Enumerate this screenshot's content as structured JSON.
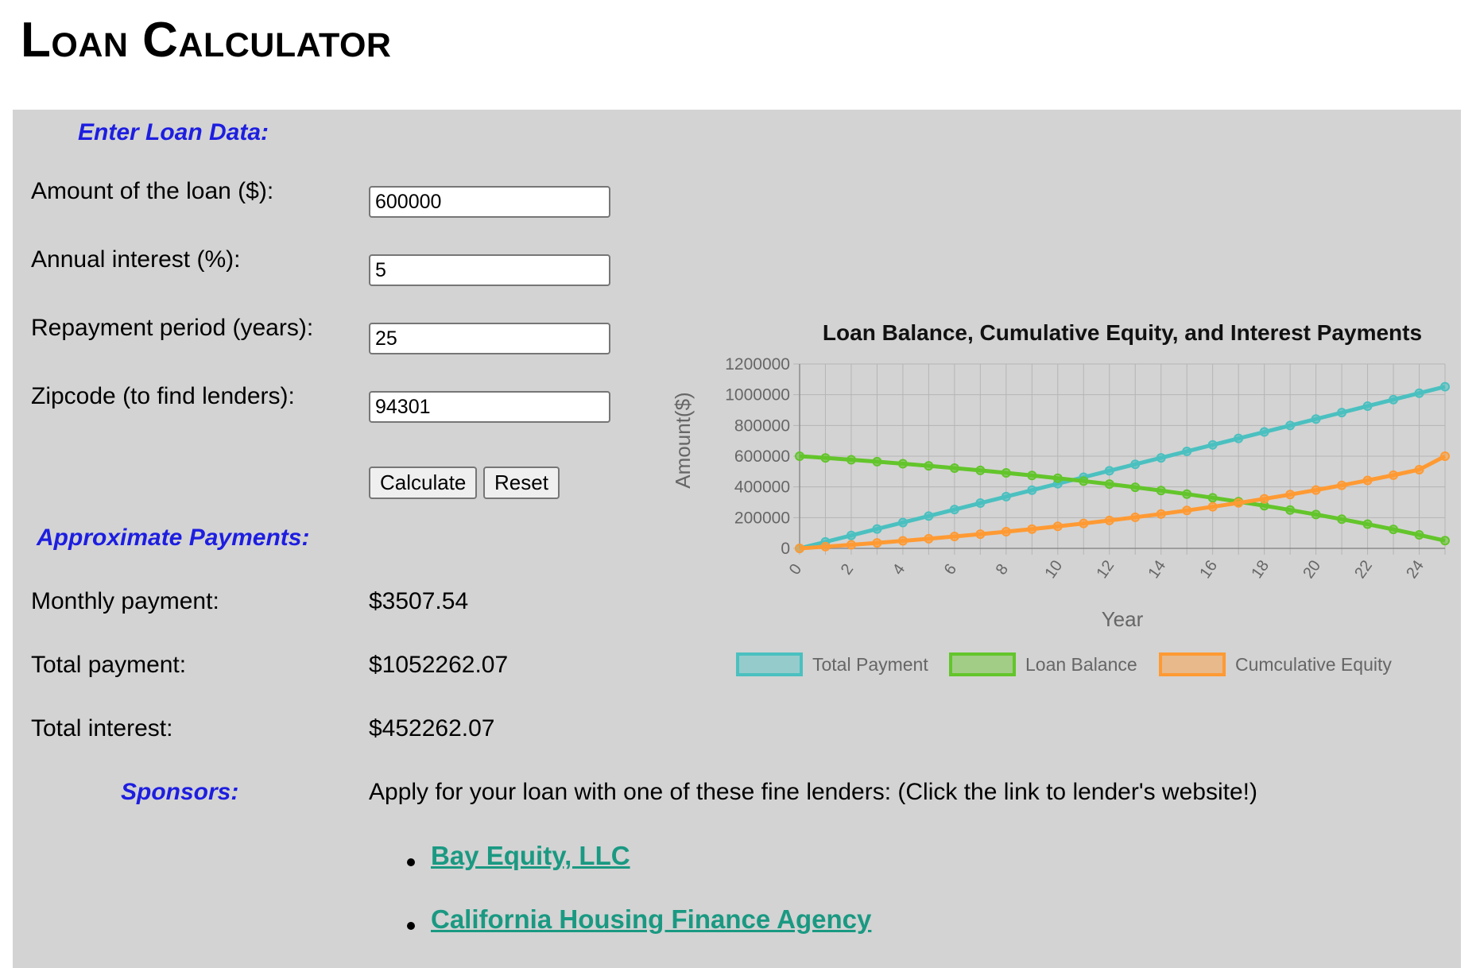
{
  "page": {
    "title": "Loan Calculator"
  },
  "form": {
    "heading": "Enter Loan Data:",
    "amount_label": "Amount of the loan ($):",
    "amount_value": "600000",
    "interest_label": "Annual interest (%):",
    "interest_value": "5",
    "period_label": "Repayment period (years):",
    "period_value": "25",
    "zip_label": "Zipcode (to find lenders):",
    "zip_value": "94301",
    "calculate_label": "Calculate",
    "reset_label": "Reset"
  },
  "results": {
    "heading": "Approximate Payments:",
    "monthly_label": "Monthly payment:",
    "monthly_value": "$3507.54",
    "total_label": "Total payment:",
    "total_value": "$1052262.07",
    "interest_label": "Total interest:",
    "interest_value": "$452262.07"
  },
  "sponsors": {
    "heading": "Sponsors:",
    "intro": "Apply for your loan with one of these fine lenders: (Click the link to lender's website!)",
    "links": [
      "Bay Equity, LLC",
      "California Housing Finance Agency"
    ]
  },
  "colors": {
    "heading_blue": "#1d1ee0",
    "link_teal": "#1a9982",
    "panel_gray": "#d3d3d3"
  },
  "chart_data": {
    "type": "line",
    "title": "Loan Balance, Cumulative Equity, and Interest Payments",
    "xlabel": "Year",
    "ylabel": "Amount($)",
    "x": [
      0,
      1,
      2,
      3,
      4,
      5,
      6,
      7,
      8,
      9,
      10,
      11,
      12,
      13,
      14,
      15,
      16,
      17,
      18,
      19,
      20,
      21,
      22,
      23,
      24,
      25
    ],
    "x_ticks": [
      0,
      2,
      4,
      6,
      8,
      10,
      12,
      14,
      16,
      18,
      20,
      22,
      24
    ],
    "y_ticks": [
      0,
      200000,
      400000,
      600000,
      800000,
      1000000,
      1200000
    ],
    "ylim": [
      0,
      1200000
    ],
    "xlim": [
      0,
      25
    ],
    "grid": true,
    "legend_position": "bottom",
    "series": [
      {
        "name": "Total Payment",
        "color": "#4bc0c0",
        "values": [
          0,
          42090,
          84181,
          126271,
          168362,
          210452,
          252543,
          294633,
          336724,
          378814,
          420905,
          462995,
          505086,
          547176,
          589267,
          631357,
          673448,
          715538,
          757629,
          799719,
          841810,
          883900,
          925991,
          968081,
          1010172,
          1052262
        ]
      },
      {
        "name": "Loan Balance",
        "color": "#63c52b",
        "values": [
          600000,
          588665,
          576750,
          564225,
          551060,
          537221,
          522674,
          507383,
          491309,
          474413,
          456653,
          437984,
          418359,
          397731,
          376047,
          353253,
          329293,
          304107,
          277632,
          249803,
          220550,
          189800,
          157477,
          123500,
          87784,
          50240
        ]
      },
      {
        "name": "Cumculative Equity",
        "color": "#ff9a33",
        "values": [
          0,
          11335,
          23250,
          35775,
          48940,
          62779,
          77326,
          92617,
          108691,
          125587,
          143347,
          162016,
          181641,
          202269,
          223953,
          246747,
          270707,
          295893,
          322368,
          350197,
          379450,
          410200,
          442523,
          476500,
          512216,
          600000
        ]
      }
    ]
  }
}
